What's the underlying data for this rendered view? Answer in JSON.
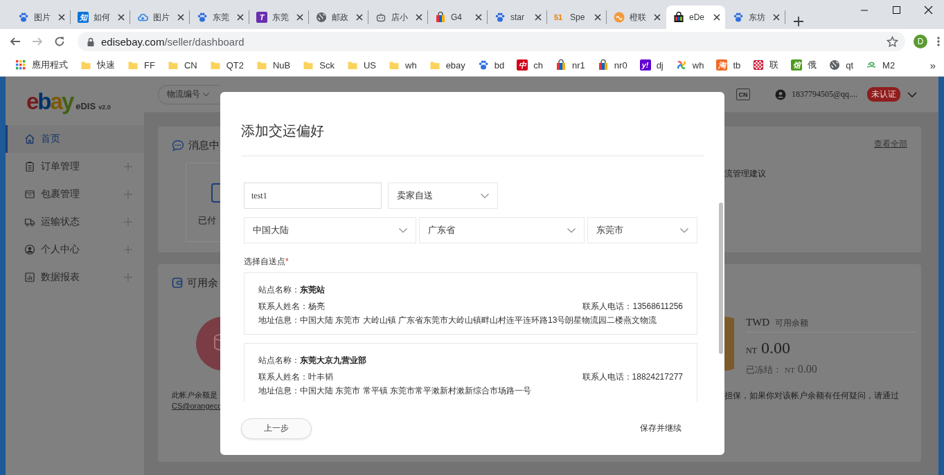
{
  "browser": {
    "tabs": [
      {
        "title": "图片",
        "kind": "paw",
        "selected": false
      },
      {
        "title": "如何",
        "kind": "letter",
        "badge": "知",
        "color": "#0a74da",
        "selected": false
      },
      {
        "title": "图片",
        "kind": "cloud",
        "selected": false
      },
      {
        "title": "东莞",
        "kind": "paw",
        "selected": false
      },
      {
        "title": "东莞",
        "kind": "letter",
        "badge": "T",
        "color": "#6a2fae",
        "selected": false
      },
      {
        "title": "邮政",
        "kind": "globe",
        "selected": false
      },
      {
        "title": "店小",
        "kind": "robot",
        "selected": false
      },
      {
        "title": "G4",
        "kind": "bag",
        "selected": false
      },
      {
        "title": "star",
        "kind": "paw",
        "selected": false
      },
      {
        "title": "Spe",
        "kind": "mark",
        "badge": "51",
        "color": "#f07c00",
        "selected": false
      },
      {
        "title": "橙联",
        "kind": "orange",
        "selected": false
      },
      {
        "title": "eDe",
        "kind": "edis",
        "selected": true
      },
      {
        "title": "东坊",
        "kind": "paw",
        "selected": false
      }
    ],
    "url": {
      "host": "edisebay.com",
      "path": "/seller/dashboard"
    },
    "profile": "D",
    "bookmarks": [
      {
        "label": "應用程式",
        "kind": "apps"
      },
      {
        "label": "快速",
        "kind": "folder"
      },
      {
        "label": "FF",
        "kind": "folder"
      },
      {
        "label": "CN",
        "kind": "folder"
      },
      {
        "label": "QT2",
        "kind": "folder"
      },
      {
        "label": "NuB",
        "kind": "folder"
      },
      {
        "label": "Sck",
        "kind": "folder"
      },
      {
        "label": "US",
        "kind": "folder"
      },
      {
        "label": "wh",
        "kind": "folder"
      },
      {
        "label": "ebay",
        "kind": "folder"
      },
      {
        "label": "bd",
        "kind": "paw"
      },
      {
        "label": "ch",
        "kind": "letter",
        "badge": "中",
        "color": "#d0021b"
      },
      {
        "label": "nr1",
        "kind": "bag"
      },
      {
        "label": "nr0",
        "kind": "bag"
      },
      {
        "label": "dj",
        "kind": "letter",
        "badge": "y!",
        "color": "#5f01d1"
      },
      {
        "label": "wh",
        "kind": "pinwheel"
      },
      {
        "label": "tb",
        "kind": "letter",
        "badge": "淘",
        "color": "#f06a23"
      },
      {
        "label": "联",
        "kind": "checker"
      },
      {
        "label": "俄",
        "kind": "letter",
        "badge": "馆",
        "color": "#4f9a1f"
      },
      {
        "label": "qt",
        "kind": "globe"
      },
      {
        "label": "M2",
        "kind": "swirl"
      }
    ],
    "more_bookmarks": "»"
  },
  "logo": {
    "wordmark": "ebay",
    "product": "eDIS",
    "version": "v2.0"
  },
  "sidebar": {
    "items": [
      {
        "label": "首页",
        "kind": "home",
        "selected": true,
        "expandable": false
      },
      {
        "label": "订单管理",
        "kind": "clipboard",
        "selected": false,
        "expandable": true
      },
      {
        "label": "包裹管理",
        "kind": "box",
        "selected": false,
        "expandable": true
      },
      {
        "label": "运输状态",
        "kind": "truck",
        "selected": false,
        "expandable": true
      },
      {
        "label": "个人中心",
        "kind": "user",
        "selected": false,
        "expandable": true
      },
      {
        "label": "数据报表",
        "kind": "chart",
        "selected": false,
        "expandable": true
      }
    ]
  },
  "header": {
    "search_type": "物流编号",
    "region_badge": "CN",
    "user_email": "1837794505@qq....",
    "status_badge": "未认证"
  },
  "dashboard": {
    "messages_card": {
      "title": "消息中",
      "view_all": "查看全部",
      "tile_label": "已付",
      "side_text": "流管理建议"
    },
    "balance_card": {
      "title": "可用余",
      "currency": "TWD",
      "available_label": "可用余额",
      "amount_prefix": "NT",
      "amount": "0.00",
      "frozen_label": "已冻结：",
      "frozen_prefix": "NT",
      "frozen_amount": "0.00",
      "note_left": "此帐户余额是",
      "email_link": "CS@orangeco",
      "note_right": "担保，如果你对该帐户余额有任何疑问，请通过"
    }
  },
  "modal": {
    "title": "添加交运偏好",
    "name_field": {
      "value": "test1"
    },
    "method_select": {
      "value": "卖家自送"
    },
    "region_selects": [
      {
        "value": "中国大陆"
      },
      {
        "value": "广东省"
      },
      {
        "value": "东莞市"
      }
    ],
    "pickup_label": "选择自送点",
    "required_mark": "*",
    "pickup_points": [
      {
        "name_line": "站点名称：**东莞站**",
        "contact": "联系人姓名：杨亮",
        "phone": "联系人电话：13568611256",
        "address": "地址信息：中国大陆 东莞市 大岭山镇 广东省东莞市大岭山镇畔山村连平连环路13号朗星物流园二楼燕文物流"
      },
      {
        "name_line": "站点名称：**东莞大京九营业部**",
        "contact": "联系人姓名：叶丰韬",
        "phone": "联系人电话：18824217277",
        "address": "地址信息：中国大陆 东莞市 常平镇 东莞市常平漱新村漱新综合市场路一号"
      }
    ],
    "back_button": "上一步",
    "save_button": "保存并继续"
  }
}
